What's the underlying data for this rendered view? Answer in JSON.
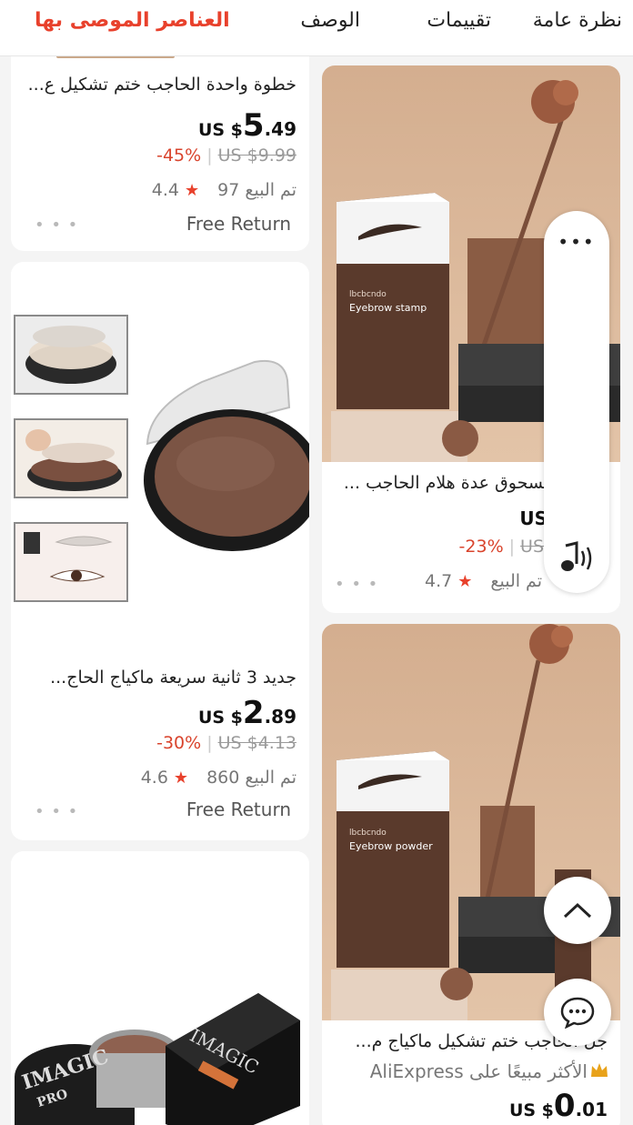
{
  "tabs": [
    {
      "label": "نظرة عامة",
      "active": false
    },
    {
      "label": "تقييمات",
      "active": false
    },
    {
      "label": "الوصف",
      "active": false
    },
    {
      "label": "العناصر الموصى بها",
      "active": true
    }
  ],
  "left_cards": [
    {
      "title": "خطوة واحدة الحاجب ختم تشكيل ع...",
      "currency": "US $",
      "price_int": "5",
      "price_dec": ".49",
      "discount": "-45%",
      "original_price": "US $9.99",
      "sold": "97 تم البيع",
      "rating": "4.4",
      "free_return": "Free Return"
    },
    {
      "title": "جديد 3 ثانية سريعة ماكياج الحاج...",
      "currency": "US $",
      "price_int": "2",
      "price_dec": ".89",
      "discount": "-30%",
      "original_price": "US $4.13",
      "sold": "860 تم البيع",
      "rating": "4.6",
      "free_return": "Free Return"
    }
  ],
  "right_cards": [
    {
      "title": "مسحوق عدة هلام الحاجب ...",
      "currency": "US",
      "discount": "-23%",
      "original_price": "US",
      "sold": "تم البيع",
      "rating": "4.7",
      "box_brand": "lbcbcndo",
      "box_label": "Eyebrow stamp"
    },
    {
      "title": "جل الحاجب ختم تشكيل ماكياج م...",
      "best_seller": "الأكثر مبيعًا على AliExpress",
      "currency": "US $",
      "price_int": "0",
      "price_dec": ".01",
      "box_brand": "lbcbcndo",
      "box_label": "Eyebrow powder"
    }
  ],
  "bottom_left_image": {
    "brand": "IMAGIC",
    "sub": "PRO"
  },
  "colors": {
    "accent": "#e8412c",
    "tan": "#d8b596",
    "brown_box": "#5a3a2c"
  },
  "icons": [
    "more-icon",
    "music-note-icon",
    "sound-waves-icon",
    "chevron-up-icon",
    "chat-bubble-icon",
    "crown-icon",
    "star-icon"
  ]
}
